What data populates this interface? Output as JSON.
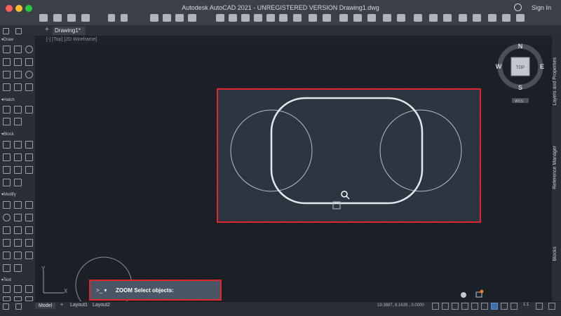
{
  "window": {
    "title": "Autodesk AutoCAD 2021 - UNREGISTERED VERSION    Drawing1.dwg",
    "sign_in": "Sign In"
  },
  "tabs": {
    "document": "Drawing1*"
  },
  "viewport": {
    "label": "[-] [Top] [2D Wireframe]"
  },
  "palette": {
    "sections": [
      "Draw",
      "Hatch",
      "Block",
      "Modify",
      "Text"
    ]
  },
  "viewcube": {
    "north": "N",
    "south": "S",
    "east": "E",
    "west": "W",
    "face": "TOP",
    "wcs": "WCS"
  },
  "ucs": {
    "y": "Y",
    "x": "X"
  },
  "right_panel": {
    "tabs": [
      "Layers and Properties",
      "Reference Manager",
      "Blocks"
    ]
  },
  "command": {
    "prompt": ">_ ▾",
    "text": "ZOOM Select objects:"
  },
  "layouts": {
    "model": "Model",
    "plus": "+",
    "layout1": "Layout1",
    "layout2": "Layout2"
  },
  "status": {
    "coordinates": "19.3887, 8.1639 , 0.0000",
    "scale": "1:1"
  },
  "colors": {
    "selection_red": "#e0262c",
    "canvas": "#1b1f26"
  }
}
